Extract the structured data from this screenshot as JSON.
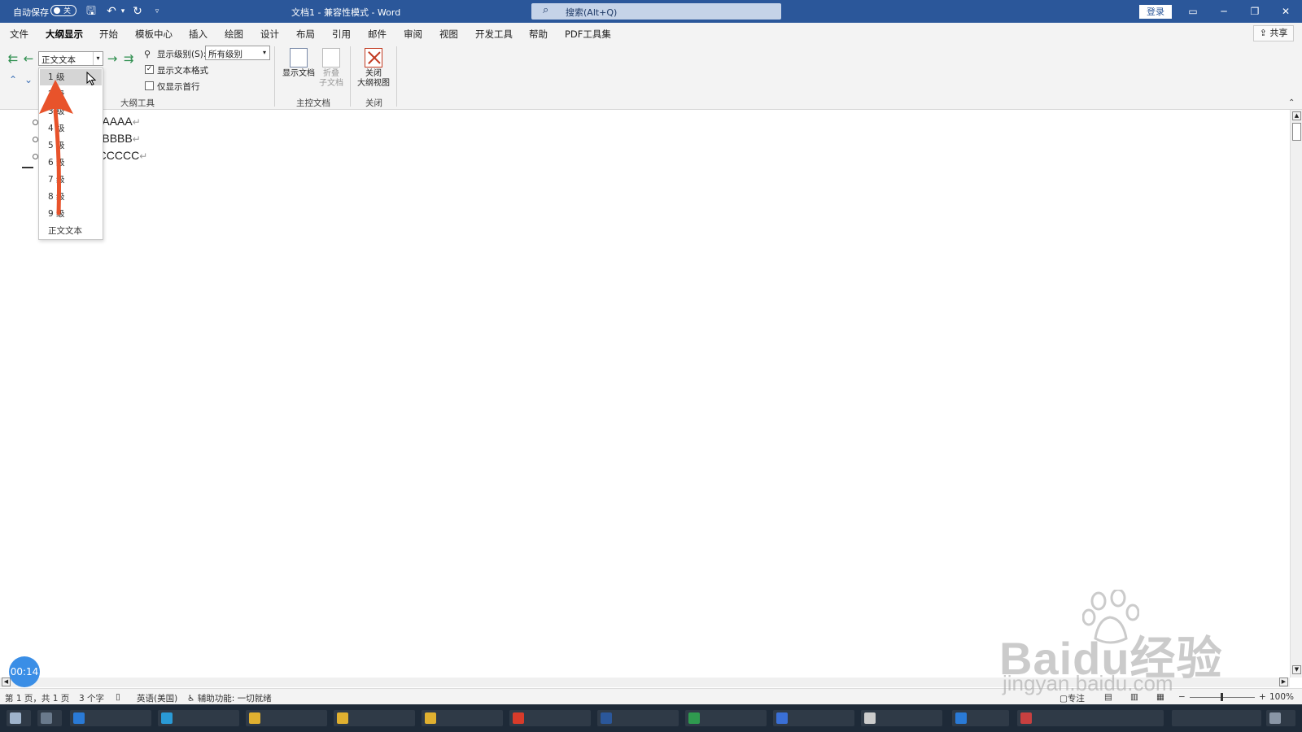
{
  "titlebar": {
    "autosave_label": "自动保存",
    "autosave_state": "关",
    "doc_title": "文档1 - 兼容性模式 - Word",
    "search_placeholder": "搜索(Alt+Q)",
    "login_label": "登录"
  },
  "menubar": {
    "items": [
      "文件",
      "大纲显示",
      "开始",
      "模板中心",
      "插入",
      "绘图",
      "设计",
      "布局",
      "引用",
      "邮件",
      "审阅",
      "视图",
      "开发工具",
      "帮助",
      "PDF工具集"
    ],
    "active": "大纲显示",
    "share_label": "共享"
  },
  "ribbon": {
    "level_combo_value": "正文文本",
    "show_level_label": "显示级别(S):",
    "show_level_value": "所有级别",
    "show_text_format_label": "显示文本格式",
    "show_text_format_checked": true,
    "show_first_line_label": "仅显示首行",
    "show_first_line_checked": false,
    "outline_tools_group": "大纲工具",
    "show_document_label": "显示文档",
    "collapse_subdoc_label_1": "折叠",
    "collapse_subdoc_label_2": "子文档",
    "master_doc_group": "主控文档",
    "close_outline_label_1": "关闭",
    "close_outline_label_2": "大纲视图",
    "close_group": "关闭"
  },
  "level_dropdown": {
    "items": [
      "1 级",
      "2 级",
      "3 级",
      "4 级",
      "5 级",
      "6 级",
      "7 级",
      "8 级",
      "9 级",
      "正文文本"
    ],
    "highlighted": "1 级"
  },
  "document": {
    "lines": [
      "AAAAAAAAAAA",
      "BBBBBBBBBBB",
      "CCCCCCCCCCC"
    ],
    "para_mark": "↵"
  },
  "statusbar": {
    "page": "第 1 页，共 1 页",
    "words": "3 个字",
    "language": "英语(美国)",
    "accessibility": "辅助功能: 一切就绪",
    "focus": "专注",
    "zoom": "100%"
  },
  "overlay": {
    "timer": "00:14",
    "watermark_main": "Baidu经验",
    "watermark_url": "jingyan.baidu.com"
  },
  "colors": {
    "title_blue": "#2b579a",
    "arrow_red": "#e8532b",
    "outline_green": "#2f8f4f"
  }
}
